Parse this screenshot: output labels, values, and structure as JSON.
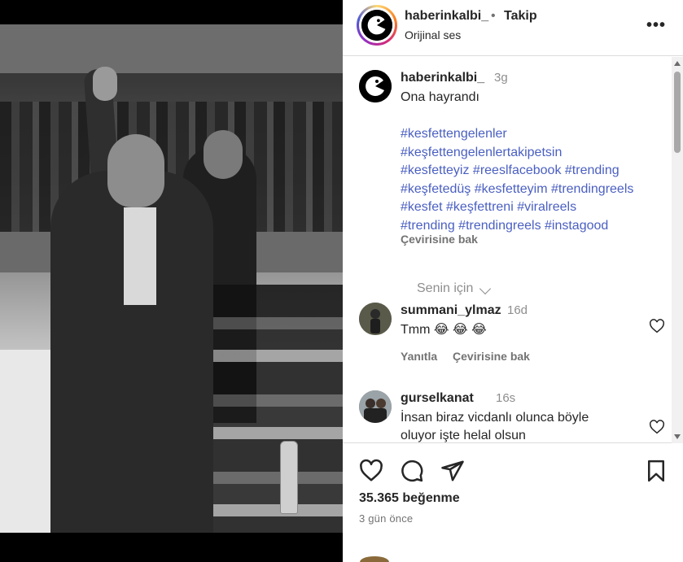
{
  "post": {
    "username": "haberinkalbi_",
    "separator": "•",
    "follow_label": "Takip",
    "audio_label": "Orijinal ses",
    "more_label": "•••"
  },
  "caption": {
    "username": "haberinkalbi_",
    "time": "3g",
    "text": "Ona hayrandı",
    "hashtag_lines": [
      "#kesfettengelenler",
      "#keşfettengelenlertakipetsin",
      "#kesfetteyiz #reeslfacebook #trending",
      "#keşfetedüş #kesfetteyim #trendingreels",
      "#kesfet #keşfettreni #viralreels",
      "#trending #trendingreels #instagood"
    ],
    "translate_label": "Çevirisine bak",
    "for_you_label": "Senin için"
  },
  "comments": [
    {
      "username": "summani_ylmaz",
      "time": "16d",
      "text": "Tmm 😂 😂 😂",
      "reply_label": "Yanıtla",
      "translate_label": "Çevirisine bak"
    },
    {
      "username": "gurselkanat",
      "time": "16s",
      "text": "İnsan biraz vicdanlı olunca böyle oluyor işte helal olsun"
    }
  ],
  "stats": {
    "likes": "35.365 beğenme",
    "date": "3 gün önce"
  },
  "colors": {
    "hashtag": "#4a5fc1",
    "secondary_text": "#737373",
    "divider": "#dbdbdb"
  },
  "icons": [
    "more-options-icon",
    "like-heart-icon",
    "comment-icon",
    "share-icon",
    "save-bookmark-icon",
    "chevron-down-icon"
  ]
}
